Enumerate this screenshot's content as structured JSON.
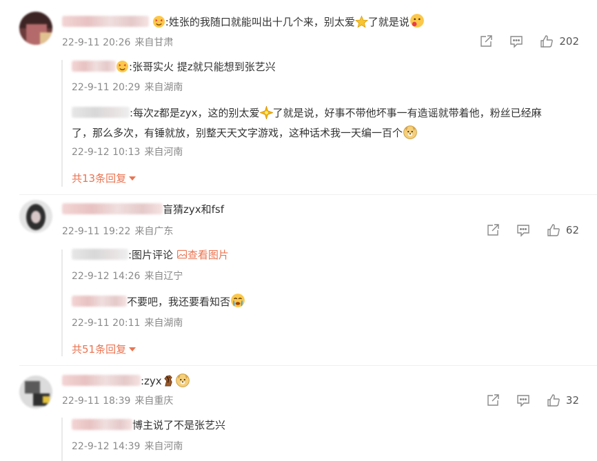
{
  "comments": [
    {
      "text_prefix": ":姓张的我随口就能叫出十几个来，别太爱",
      "text_mid": "了就是说",
      "date": "22-9-11 20:26",
      "location": "来自甘肃",
      "likes": "202",
      "replies": [
        {
          "text": ":张哥实火 提z就只能想到张艺兴",
          "date": "22-9-11 20:29",
          "location": "来自湖南"
        },
        {
          "text_line1_a": ":每次z都是zyx，这的别太爱",
          "text_line1_b": "了就是说，好事不带他坏事一有造谣就带着他，粉丝已经麻",
          "text_line2": "了，那么多次，有锤就放，别整天天文字游戏，这种话术我一天编一百个",
          "date": "22-9-12 10:13",
          "location": "来自河南"
        }
      ],
      "more_replies": "共13条回复"
    },
    {
      "text": "盲猜zyx和fsf",
      "date": "22-9-11 19:22",
      "location": "来自广东",
      "likes": "62",
      "replies": [
        {
          "text": ":图片评论",
          "link": "查看图片",
          "date": "22-9-12 14:26",
          "location": "来自辽宁"
        },
        {
          "text": "不要吧，我还要看知否",
          "date": "22-9-11 20:11",
          "location": "来自湖南"
        }
      ],
      "more_replies": "共51条回复"
    },
    {
      "text": ":zyx",
      "date": "22-9-11 18:39",
      "location": "来自重庆",
      "likes": "32",
      "replies": [
        {
          "text": "博主说了不是张艺兴",
          "date": "22-9-12 14:39",
          "location": "来自河南"
        }
      ]
    }
  ],
  "icons": [
    "share-icon",
    "comment-icon",
    "like-icon",
    "image-icon",
    "caret-down-icon"
  ],
  "colors": {
    "accent": "#eb7350",
    "meta": "#8a8a8a",
    "text": "#333333"
  }
}
